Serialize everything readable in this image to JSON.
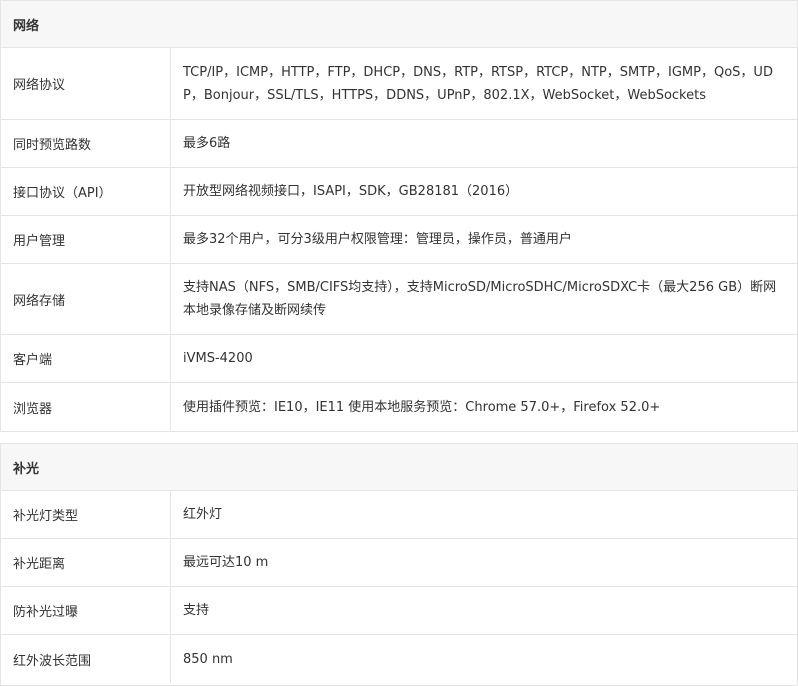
{
  "sections": [
    {
      "title": "网络",
      "rows": [
        {
          "label": "网络协议",
          "value": "TCP/IP，ICMP，HTTP，FTP，DHCP，DNS，RTP，RTSP，RTCP，NTP，SMTP，IGMP，QoS，UDP，Bonjour，SSL/TLS，HTTPS，DDNS，UPnP，802.1X，WebSocket，WebSockets"
        },
        {
          "label": "同时预览路数",
          "value": "最多6路"
        },
        {
          "label": "接口协议（API）",
          "value": "开放型网络视频接口，ISAPI，SDK，GB28181（2016）"
        },
        {
          "label": "用户管理",
          "value": "最多32个用户，可分3级用户权限管理：管理员，操作员，普通用户"
        },
        {
          "label": "网络存储",
          "value": "支持NAS（NFS，SMB/CIFS均支持），支持MicroSD/MicroSDHC/MicroSDXC卡（最大256 GB）断网本地录像存储及断网续传"
        },
        {
          "label": "客户端",
          "value": "iVMS-4200"
        },
        {
          "label": "浏览器",
          "value": "使用插件预览：IE10，IE11 使用本地服务预览：Chrome 57.0+，Firefox 52.0+"
        }
      ]
    },
    {
      "title": "补光",
      "rows": [
        {
          "label": "补光灯类型",
          "value": "红外灯"
        },
        {
          "label": "补光距离",
          "value": "最远可达10 m"
        },
        {
          "label": "防补光过曝",
          "value": "支持"
        },
        {
          "label": "红外波长范围",
          "value": "850 nm"
        }
      ]
    }
  ]
}
